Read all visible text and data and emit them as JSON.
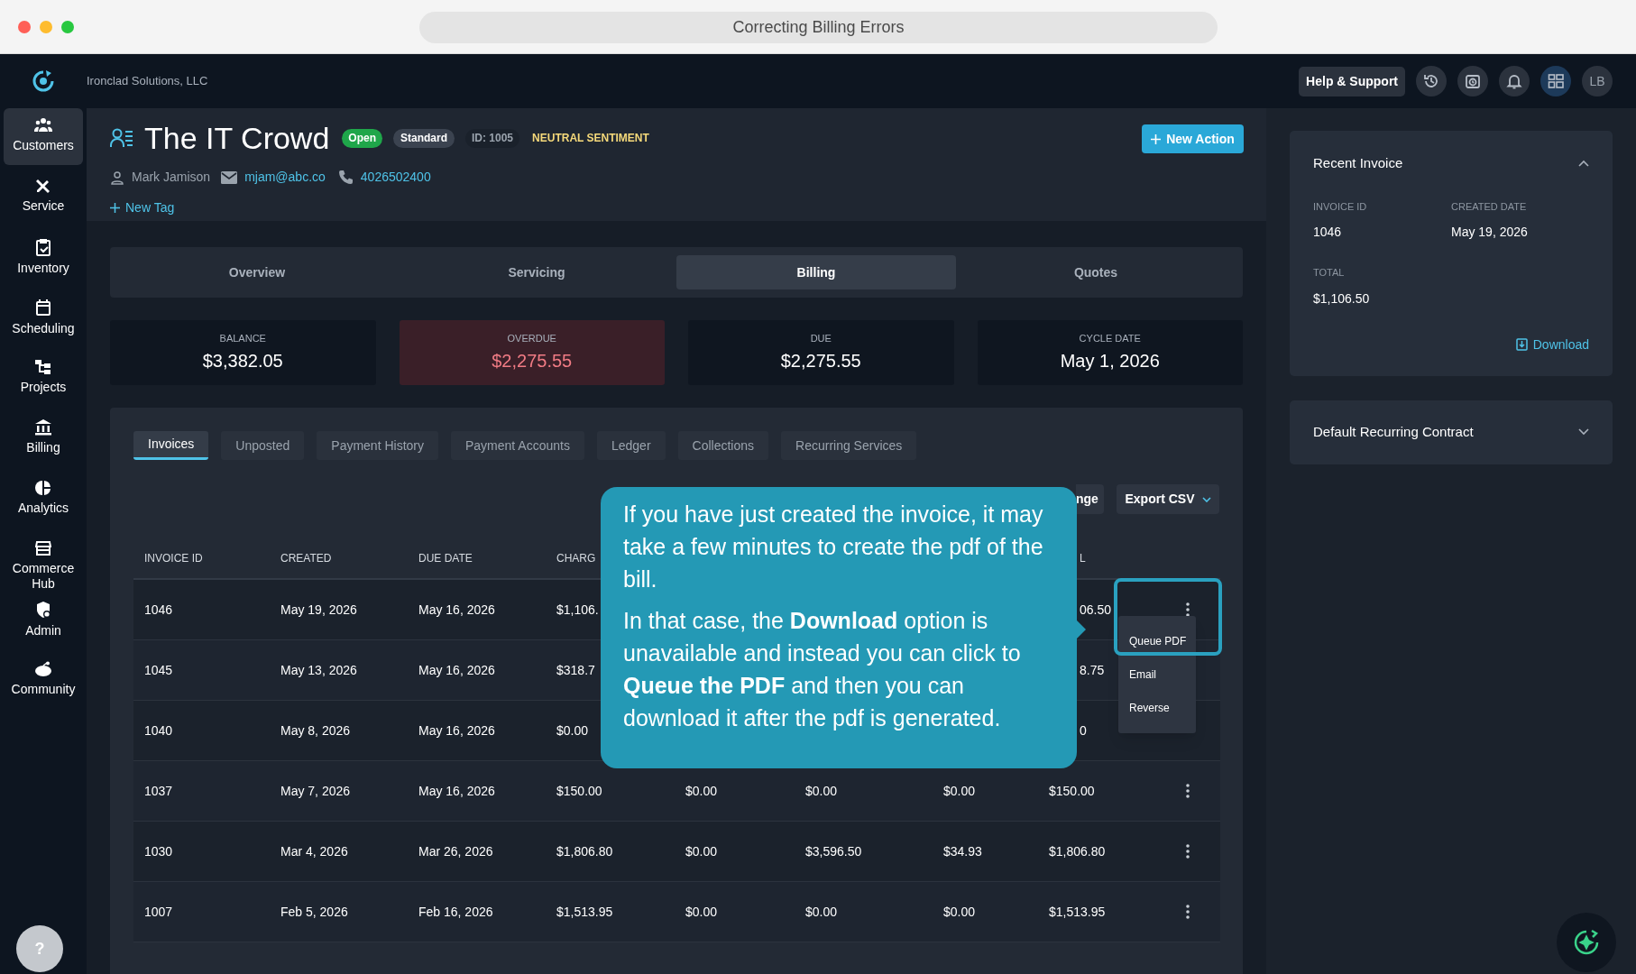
{
  "window": {
    "title": "Correcting Billing Errors"
  },
  "app_bar": {
    "company": "Ironclad Solutions, LLC",
    "help_button": "Help & Support",
    "avatar": "LB"
  },
  "sidebar": {
    "items": [
      {
        "label": "Customers",
        "selected": true
      },
      {
        "label": "Service",
        "selected": false
      },
      {
        "label": "Inventory",
        "selected": false
      },
      {
        "label": "Scheduling",
        "selected": false
      },
      {
        "label": "Projects",
        "selected": false
      },
      {
        "label": "Billing",
        "selected": false
      },
      {
        "label": "Analytics",
        "selected": false
      },
      {
        "label": "Commerce Hub",
        "selected": false
      },
      {
        "label": "Admin",
        "selected": false
      },
      {
        "label": "Community",
        "selected": false
      }
    ],
    "help": "?"
  },
  "customer": {
    "name": "The IT Crowd",
    "badges": [
      {
        "text": "Open",
        "kind": "status"
      },
      {
        "text": "Standard",
        "kind": "tier"
      },
      {
        "text": "ID: 1005",
        "kind": "id"
      },
      {
        "text": "NEUTRAL SENTIMENT",
        "kind": "sentiment"
      }
    ],
    "contact": "Mark Jamison",
    "email": "mjam@abc.co",
    "phone": "4026502400",
    "new_tag": "New Tag",
    "action_button": "New Action"
  },
  "tabs": [
    {
      "label": "Overview",
      "selected": false
    },
    {
      "label": "Servicing",
      "selected": false
    },
    {
      "label": "Billing",
      "selected": true
    },
    {
      "label": "Quotes",
      "selected": false
    }
  ],
  "stats": [
    {
      "label": "BALANCE",
      "value": "$3,382.05",
      "kind": "normal"
    },
    {
      "label": "OVERDUE",
      "value": "$2,275.55",
      "kind": "alert"
    },
    {
      "label": "DUE",
      "value": "$2,275.55",
      "kind": "normal"
    },
    {
      "label": "CYCLE DATE",
      "value": "May 1, 2026",
      "kind": "normal"
    }
  ],
  "subtabs": [
    {
      "label": "Invoices",
      "selected": true
    },
    {
      "label": "Unposted",
      "selected": false
    },
    {
      "label": "Payment History",
      "selected": false
    },
    {
      "label": "Payment Accounts",
      "selected": false
    },
    {
      "label": "Ledger",
      "selected": false
    },
    {
      "label": "Collections",
      "selected": false
    },
    {
      "label": "Recurring Services",
      "selected": false
    }
  ],
  "toolbar": {
    "partial_button": "nge",
    "export_button": "Export CSV"
  },
  "table": {
    "columns": [
      "INVOICE ID",
      "CREATED",
      "DUE DATE",
      "CHARG"
    ],
    "last_column": "L",
    "rows": [
      {
        "kind": "covered",
        "menu_open": true,
        "cells": [
          "1046",
          "May 19, 2026",
          "May 16, 2026",
          "$1,106.",
          "06.50"
        ]
      },
      {
        "kind": "covered",
        "menu_open": false,
        "cells": [
          "1045",
          "May 13, 2026",
          "May 16, 2026",
          "$318.7",
          "8.75"
        ]
      },
      {
        "kind": "covered",
        "menu_open": false,
        "cells": [
          "1040",
          "May 8, 2026",
          "May 16, 2026",
          "$0.00",
          "0"
        ]
      },
      {
        "kind": "full",
        "menu_open": false,
        "cells": [
          "1037",
          "May 7, 2026",
          "May 16, 2026",
          "$150.00",
          "$0.00",
          "$0.00",
          "$0.00",
          "$150.00"
        ]
      },
      {
        "kind": "full",
        "menu_open": false,
        "cells": [
          "1030",
          "Mar 4, 2026",
          "Mar 26, 2026",
          "$1,806.80",
          "$0.00",
          "$3,596.50",
          "$34.93",
          "$1,806.80"
        ]
      },
      {
        "kind": "full",
        "menu_open": false,
        "cells": [
          "1007",
          "Feb 5, 2026",
          "Feb 16, 2026",
          "$1,513.95",
          "$0.00",
          "$0.00",
          "$0.00",
          "$1,513.95"
        ]
      }
    ]
  },
  "row_menu": {
    "items": [
      {
        "label": "Queue PDF",
        "highlighted": true
      },
      {
        "label": "Email",
        "highlighted": false
      },
      {
        "label": "Reverse",
        "highlighted": false
      }
    ]
  },
  "callout": {
    "paragraphs": [
      "If you have just created the invoice, it may take a few minutes to create the pdf of the bill.",
      "In that case, the **Download** option is unavailable and instead you can click to **Queue the PDF** and then you can download it after the pdf is generated."
    ]
  },
  "recent_invoice": {
    "title": "Recent Invoice",
    "expanded": true,
    "fields": [
      {
        "label": "INVOICE ID",
        "value": "1046"
      },
      {
        "label": "CREATED DATE",
        "value": "May 19, 2026"
      },
      {
        "label": "TOTAL",
        "value": "$1,106.50"
      }
    ],
    "download": "Download"
  },
  "contract": {
    "title": "Default Recurring Contract",
    "expanded": false
  }
}
